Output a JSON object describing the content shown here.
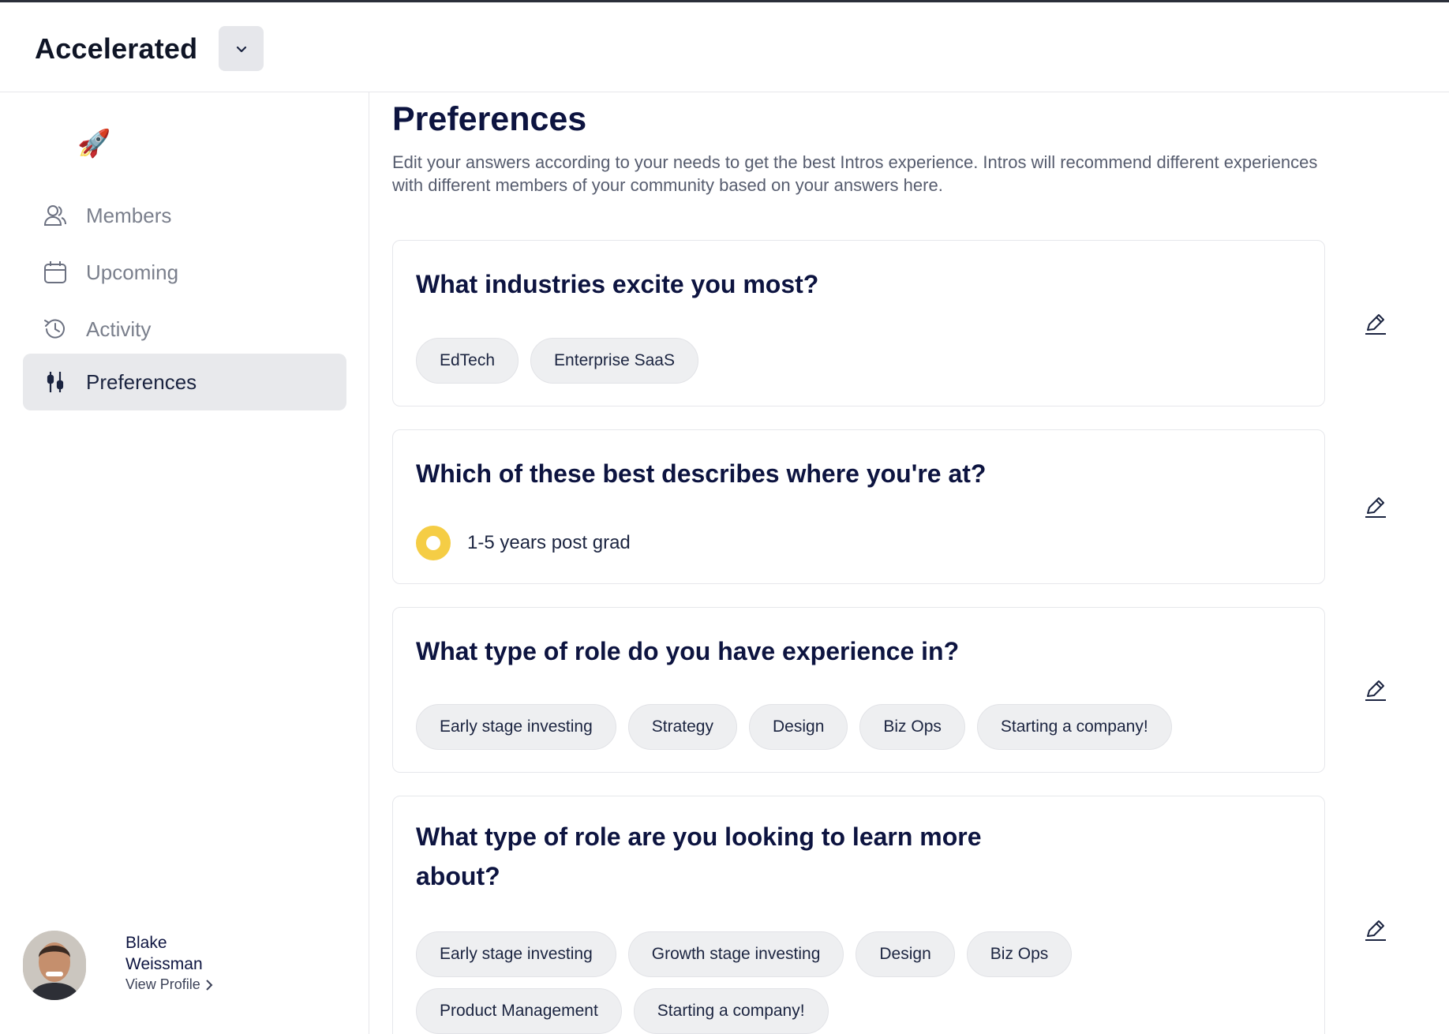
{
  "header": {
    "app_name": "Accelerated",
    "switcher_icon": "chevron-down-icon"
  },
  "sidebar": {
    "logo": "🚀",
    "items": [
      {
        "label": "Members",
        "icon": "users-icon",
        "active": false
      },
      {
        "label": "Upcoming",
        "icon": "calendar-icon",
        "active": false
      },
      {
        "label": "Activity",
        "icon": "history-icon",
        "active": false
      },
      {
        "label": "Preferences",
        "icon": "sliders-icon",
        "active": true
      }
    ],
    "profile": {
      "name": "Blake Weissman",
      "link_label": "View Profile"
    }
  },
  "main": {
    "title": "Preferences",
    "description": "Edit your answers according to your needs to get the best Intros experience. Intros will recommend different experiences with different members of your community based on your answers here.",
    "questions": [
      {
        "question": "What industries excite you most?",
        "type": "chips",
        "answers": [
          "EdTech",
          "Enterprise SaaS"
        ]
      },
      {
        "question": "Which of these best describes where you're at?",
        "type": "radio",
        "answers": [
          "1-5 years post grad"
        ]
      },
      {
        "question": "What type of role do you have experience in?",
        "type": "chips",
        "answers": [
          "Early stage investing",
          "Strategy",
          "Design",
          "Biz Ops",
          "Starting a company!"
        ]
      },
      {
        "question": "What type of role are you looking to learn more about?",
        "type": "chips",
        "answers": [
          "Early stage investing",
          "Growth stage investing",
          "Design",
          "Biz Ops",
          "Product Management",
          "Starting a company!"
        ]
      }
    ]
  },
  "colors": {
    "accent_yellow": "#f5cd45",
    "heading_navy": "#0d1440",
    "active_nav_bg": "#e8e9ec"
  }
}
